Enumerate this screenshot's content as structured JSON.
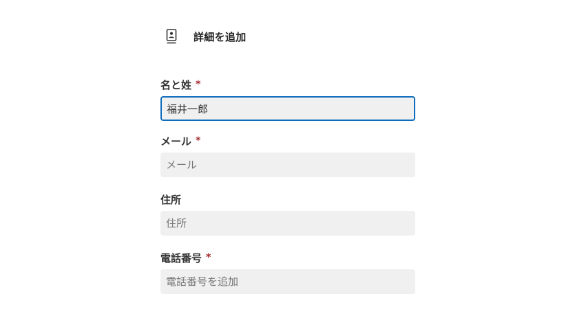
{
  "section": {
    "title": "詳細を追加",
    "icon": "contact-card-icon"
  },
  "fields": {
    "name": {
      "label": "名と姓",
      "required_marker": "*",
      "value": "福井一郎",
      "placeholder": ""
    },
    "email": {
      "label": "メール",
      "required_marker": "*",
      "value": "",
      "placeholder": "メール"
    },
    "address": {
      "label": "住所",
      "value": "",
      "placeholder": "住所"
    },
    "phone": {
      "label": "電話番号",
      "required_marker": "*",
      "value": "",
      "placeholder": "電話番号を追加"
    }
  },
  "colors": {
    "focus_border": "#0f6cbd",
    "required": "#a4262c",
    "input_background": "#f0f0f0"
  }
}
